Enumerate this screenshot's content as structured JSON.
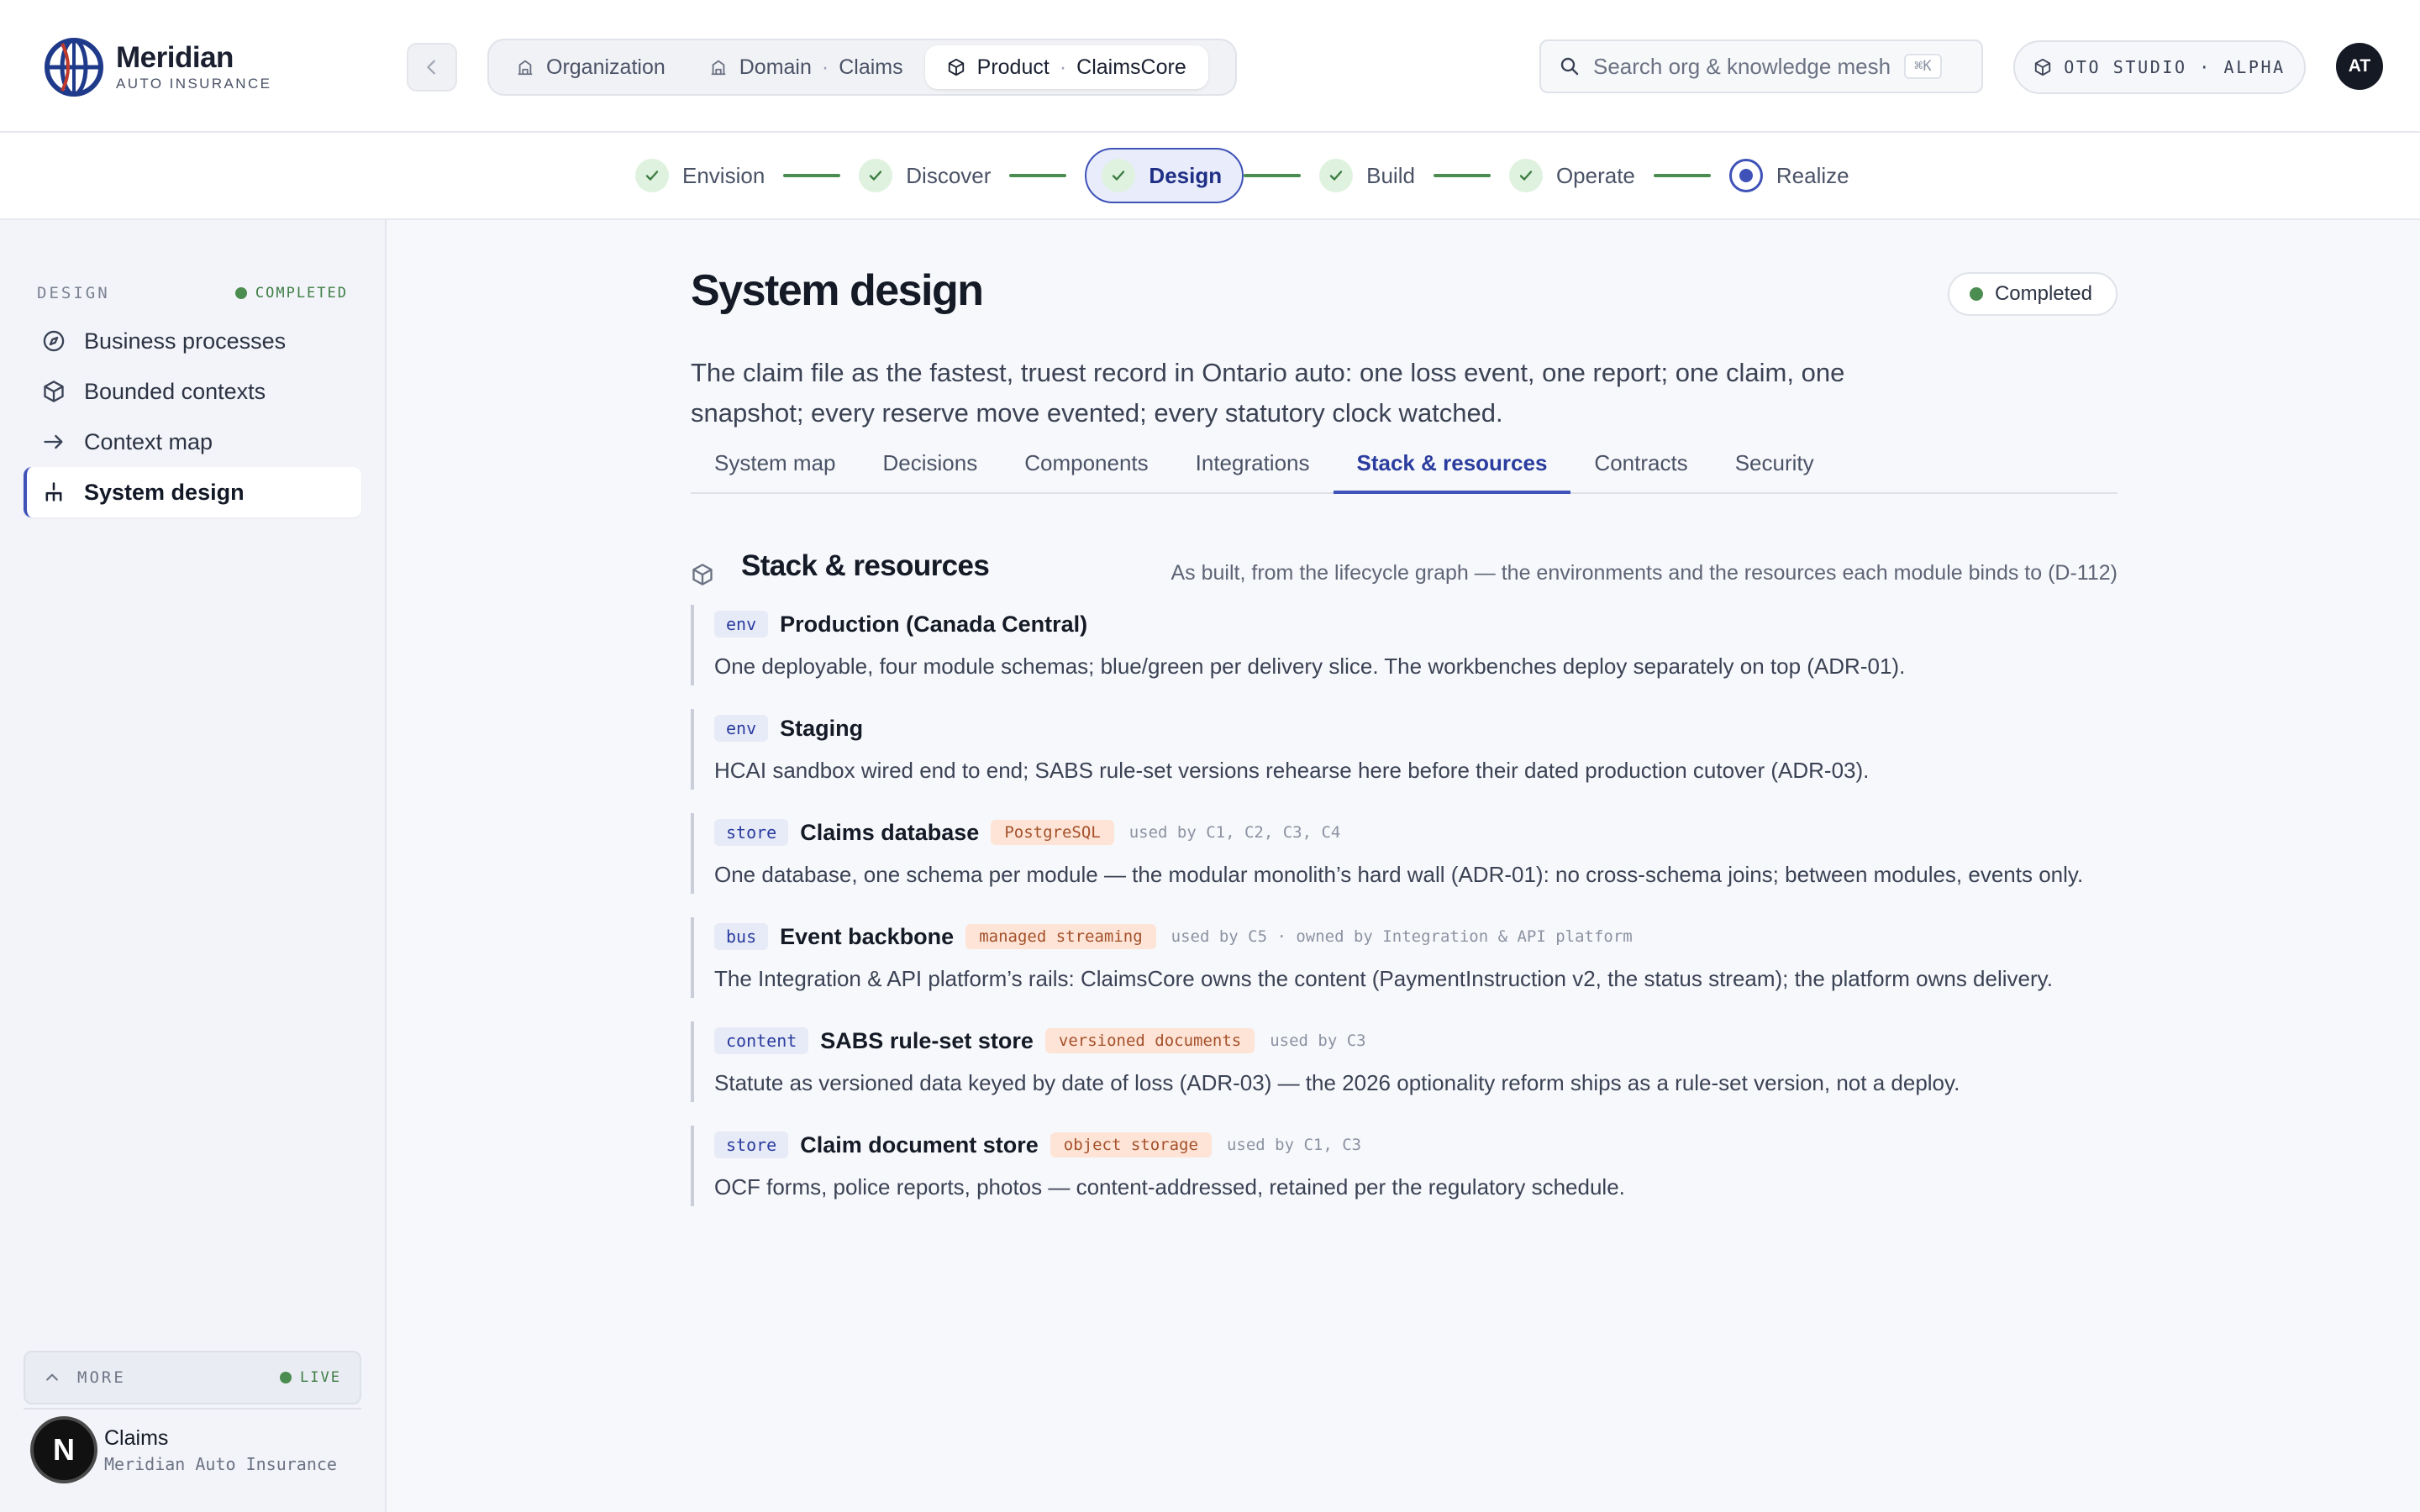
{
  "brand": {
    "name": "Meridian",
    "sub": "AUTO INSURANCE"
  },
  "breadcrumbs": [
    {
      "label": "Organization",
      "value": ""
    },
    {
      "label": "Domain",
      "value": "Claims"
    },
    {
      "label": "Product",
      "value": "ClaimsCore"
    }
  ],
  "search": {
    "placeholder": "Search org & knowledge mesh",
    "shortcut": "⌘K"
  },
  "studio": {
    "label": "OTO STUDIO · ALPHA"
  },
  "user_initials": "AT",
  "stepper": [
    {
      "label": "Envision",
      "state": "done"
    },
    {
      "label": "Discover",
      "state": "done"
    },
    {
      "label": "Design",
      "state": "active"
    },
    {
      "label": "Build",
      "state": "done"
    },
    {
      "label": "Operate",
      "state": "done"
    },
    {
      "label": "Realize",
      "state": "current"
    }
  ],
  "sidebar": {
    "section": "DESIGN",
    "status": "COMPLETED",
    "items": [
      {
        "label": "Business processes",
        "icon": "compass-icon"
      },
      {
        "label": "Bounded contexts",
        "icon": "cube-icon"
      },
      {
        "label": "Context map",
        "icon": "arrow-right-icon"
      },
      {
        "label": "System design",
        "icon": "hierarchy-icon"
      }
    ],
    "more": "MORE",
    "live": "LIVE",
    "account": {
      "badge": "N",
      "name": "Claims",
      "org": "Meridian Auto Insurance"
    }
  },
  "page": {
    "title": "System design",
    "status": "Completed",
    "lede": "The claim file as the fastest, truest record in Ontario auto: one loss event, one report; one claim, one snapshot; every reserve move evented; every statutory clock watched.",
    "tabs": [
      "System map",
      "Decisions",
      "Components",
      "Integrations",
      "Stack & resources",
      "Contracts",
      "Security"
    ],
    "active_tab": "Stack & resources"
  },
  "section": {
    "title": "Stack & resources",
    "note": "As built, from the lifecycle graph — the environments and the resources each module binds to (D-112)"
  },
  "resources": [
    {
      "kind": "env",
      "name": "Production (Canada Central)",
      "tech": "",
      "used_by": "",
      "desc": "One deployable, four module schemas; blue/green per delivery slice. The workbenches deploy separately on top (ADR-01)."
    },
    {
      "kind": "env",
      "name": "Staging",
      "tech": "",
      "used_by": "",
      "desc": "HCAI sandbox wired end to end; SABS rule-set versions rehearse here before their dated production cutover (ADR-03)."
    },
    {
      "kind": "store",
      "name": "Claims database",
      "tech": "PostgreSQL",
      "used_by": "used by C1, C2, C3, C4",
      "desc": "One database, one schema per module — the modular monolith’s hard wall (ADR-01): no cross-schema joins; between modules, events only."
    },
    {
      "kind": "bus",
      "name": "Event backbone",
      "tech": "managed streaming",
      "used_by": "used by C5 · owned by Integration & API platform",
      "desc": "The Integration & API platform’s rails: ClaimsCore owns the content (PaymentInstruction v2, the status stream); the platform owns delivery."
    },
    {
      "kind": "content",
      "name": "SABS rule-set store",
      "tech": "versioned documents",
      "used_by": "used by C3",
      "desc": "Statute as versioned data keyed by date of loss (ADR-03) — the 2026 optionality reform ships as a rule-set version, not a deploy."
    },
    {
      "kind": "store",
      "name": "Claim document store",
      "tech": "object storage",
      "used_by": "used by C1, C3",
      "desc": "OCF forms, police reports, photos — content-addressed, retained per the regulatory schedule."
    }
  ],
  "colors": {
    "accent": "#3e52b8",
    "success": "#4b8c50",
    "tech_tag": "#fde4d6"
  }
}
